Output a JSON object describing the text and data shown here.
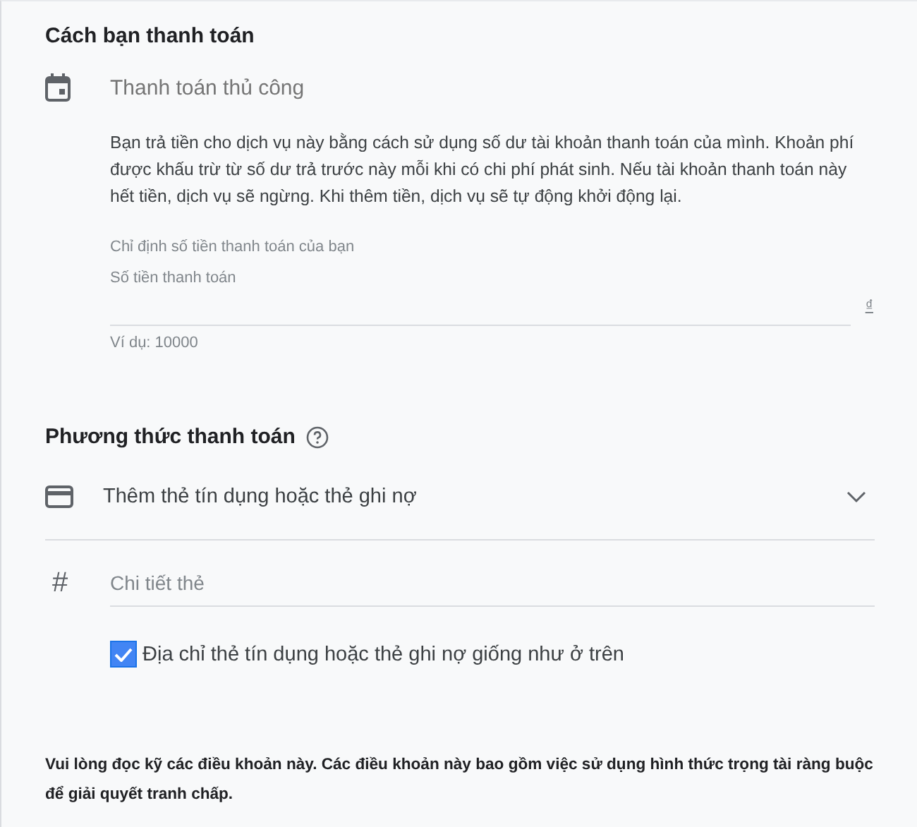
{
  "payment_schedule": {
    "title": "Cách bạn thanh toán",
    "option": "Thanh toán thủ công",
    "description": "Bạn trả tiền cho dịch vụ này bằng cách sử dụng số dư tài khoản thanh toán của mình. Khoản phí được khấu trừ từ số dư trả trước này mỗi khi có chi phí phát sinh. Nếu tài khoản thanh toán này hết tiền, dịch vụ sẽ ngừng. Khi thêm tiền, dịch vụ sẽ tự động khởi động lại.",
    "amount_prompt": "Chỉ định số tiền thanh toán của bạn",
    "amount_field": {
      "label": "Số tiền thanh toán",
      "currency": "₫",
      "hint": "Ví dụ: 10000"
    }
  },
  "payment_method": {
    "title": "Phương thức thanh toán",
    "card_select": {
      "label": "Thêm thẻ tín dụng hoặc thẻ ghi nợ",
      "expanded": false
    },
    "card_details": {
      "icon": "#",
      "placeholder": "Chi tiết thẻ"
    },
    "same_address": {
      "label": "Địa chỉ thẻ tín dụng hoặc thẻ ghi nợ giống như ở trên",
      "checked": true
    }
  },
  "terms": "Vui lòng đọc kỹ các điều khoản này. Các điều khoản này bao gồm việc sử dụng hình thức trọng tài ràng buộc để giải quyết tranh chấp."
}
